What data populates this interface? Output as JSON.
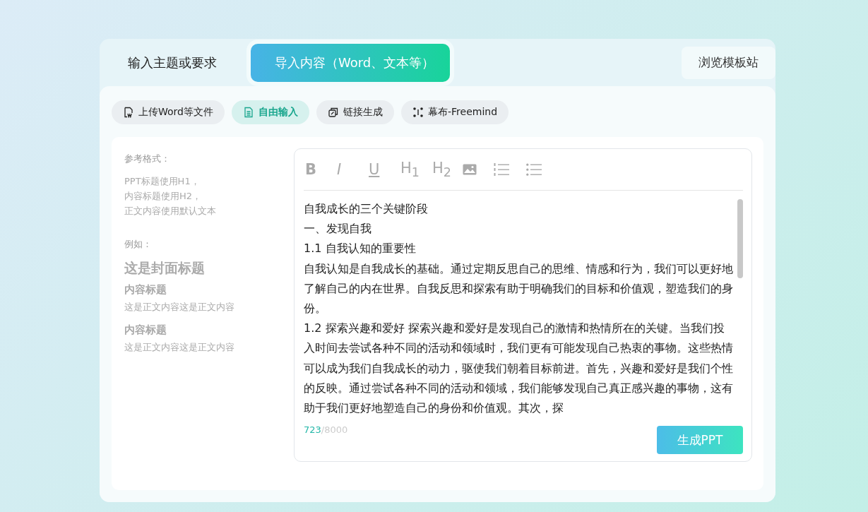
{
  "tabs": [
    {
      "label": "输入主题或要求",
      "selected": false
    },
    {
      "label": "导入内容（Word、文本等）",
      "selected": true
    }
  ],
  "template_button": "浏览模板站",
  "modes": [
    {
      "label": "上传Word等文件",
      "kind": "word",
      "selected": false
    },
    {
      "label": "自由输入",
      "kind": "doc",
      "selected": true
    },
    {
      "label": "链接生成",
      "kind": "link",
      "selected": false
    },
    {
      "label": "幕布-Freemind",
      "kind": "mind",
      "selected": false
    }
  ],
  "guide": {
    "title": "参考格式：",
    "rules": [
      "PPT标题使用H1，",
      "内容标题使用H2，",
      "正文内容使用默认文本"
    ],
    "example_label": "例如：",
    "cover_title": "这是封面标题",
    "sections": [
      {
        "heading": "内容标题",
        "body": "这是正文内容这是正文内容"
      },
      {
        "heading": "内容标题",
        "body": "这是正文内容这是正文内容"
      }
    ]
  },
  "toolbar": [
    {
      "kind": "bold",
      "label": "B"
    },
    {
      "kind": "italic",
      "label": "I"
    },
    {
      "kind": "underline",
      "label": "U"
    },
    {
      "kind": "heading",
      "label": "H$_{1}$"
    },
    {
      "kind": "heading",
      "label": "H$_{2}$"
    },
    {
      "kind": "image"
    },
    {
      "kind": "ordered"
    },
    {
      "kind": "bullet"
    }
  ],
  "editor_paragraphs": [
    "自我成长的三个关键阶段",
    "一、发现自我",
    "1.1 自我认知的重要性",
    "自我认知是自我成长的基础。通过定期反思自己的思维、情感和行为，我们可以更好地了解自己的内在世界。自我反思和探索有助于明确我们的目标和价值观，塑造我们的身份。",
    "1.2 探索兴趣和爱好 探索兴趣和爱好是发现自己的激情和热情所在的关键。当我们投入时间去尝试各种不同的活动和领域时，我们更有可能发现自己热衷的事物。这些热情可以成为我们自我成长的动力，驱使我们朝着目标前进。首先，兴趣和爱好是我们个性的反映。通过尝试各种不同的活动和领域，我们能够发现自己真正感兴趣的事物，这有助于我们更好地塑造自己的身份和价值观。其次，探"
  ],
  "char_count": "723",
  "char_limit": "/8000",
  "generate_button": "生成PPT"
}
